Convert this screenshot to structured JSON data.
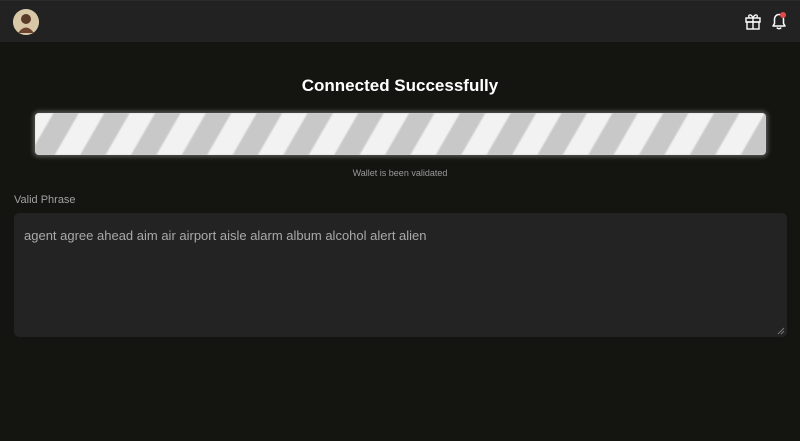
{
  "header": {
    "avatar_icon": "user-avatar",
    "gift_icon": "gift-icon",
    "bell_icon": "bell-icon",
    "notification_color": "#e14b4b"
  },
  "main": {
    "title": "Connected Successfully",
    "progress_percent": 100,
    "status_text": "Wallet is been validated",
    "phrase_label": "Valid Phrase",
    "phrase_value": "agent agree ahead aim air airport aisle alarm album alcohol alert alien"
  },
  "colors": {
    "background": "#141511",
    "topbar": "#222222",
    "field_background": "#232323"
  }
}
